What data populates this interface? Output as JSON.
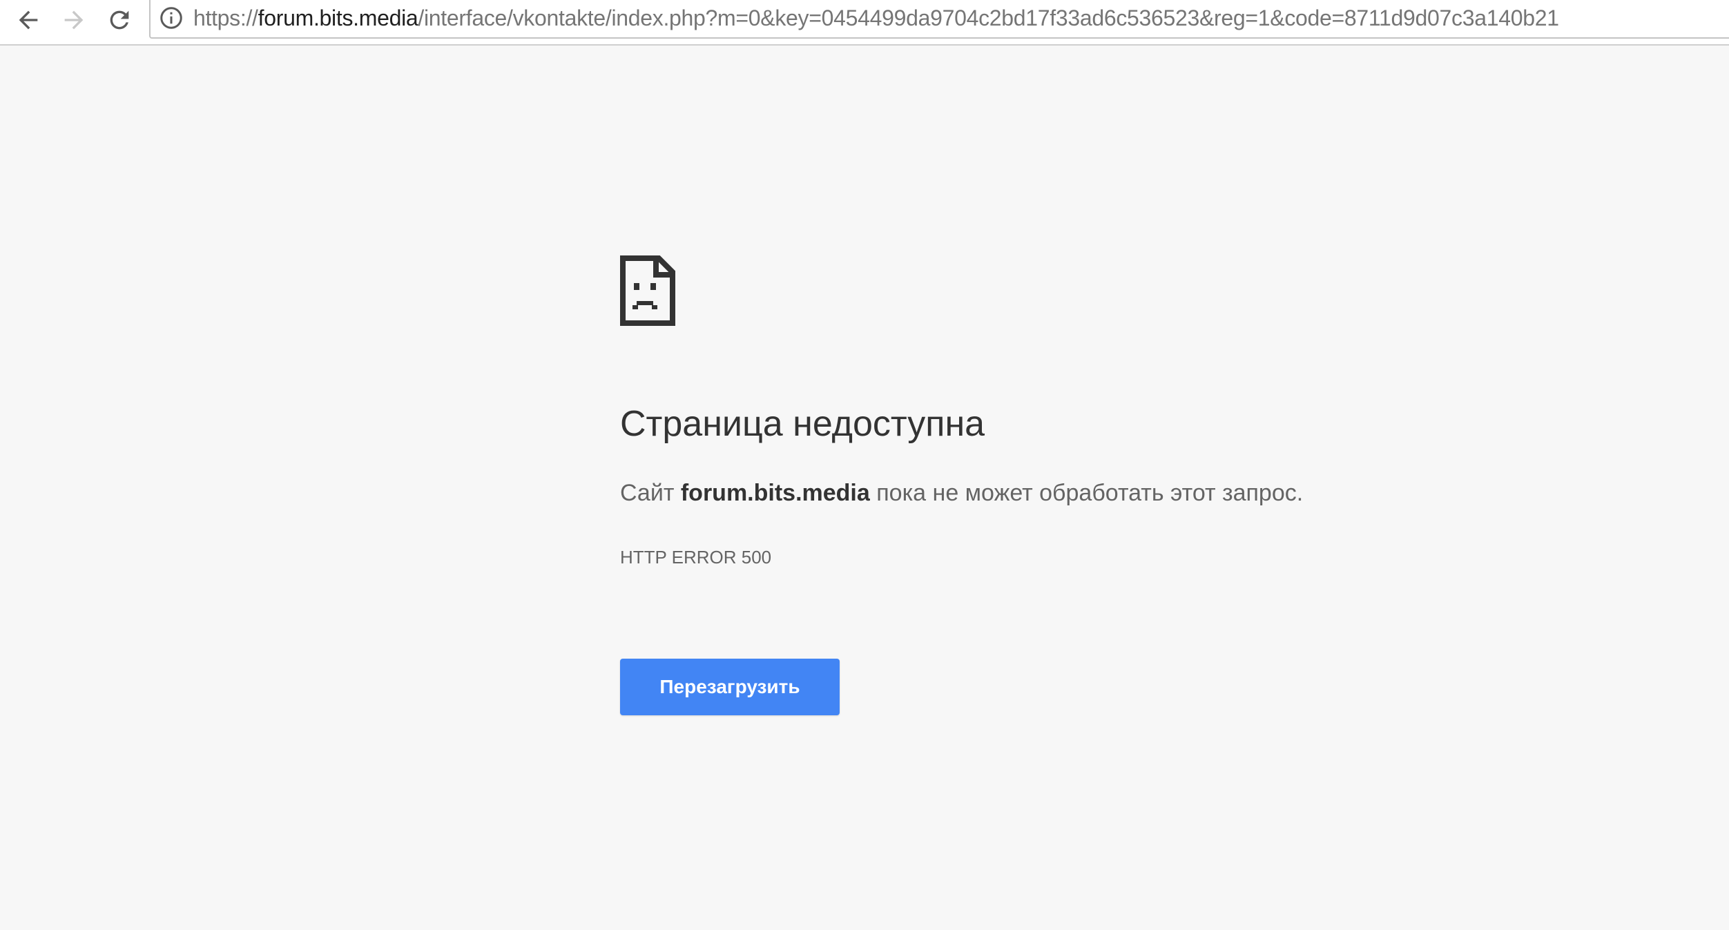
{
  "browser": {
    "url_scheme": "https://",
    "url_host": "forum.bits.media",
    "url_rest": "/interface/vkontakte/index.php?m=0&key=0454499da9704c2bd17f33ad6c536523&reg=1&code=8711d9d07c3a140b21",
    "icons": {
      "back": "arrow-left-icon",
      "forward": "arrow-right-icon",
      "reload": "reload-icon",
      "site_info": "info-circle-icon"
    }
  },
  "error_page": {
    "icon": "sad-document-icon",
    "title": "Страница недоступна",
    "desc_prefix": "Сайт ",
    "desc_host": "forum.bits.media",
    "desc_suffix": " пока не может обработать этот запрос.",
    "error_code": "HTTP ERROR 500",
    "reload_button_label": "Перезагрузить",
    "colors": {
      "button": "#4285f4",
      "background": "#f7f7f7",
      "title": "#333333",
      "text": "#646464"
    }
  }
}
